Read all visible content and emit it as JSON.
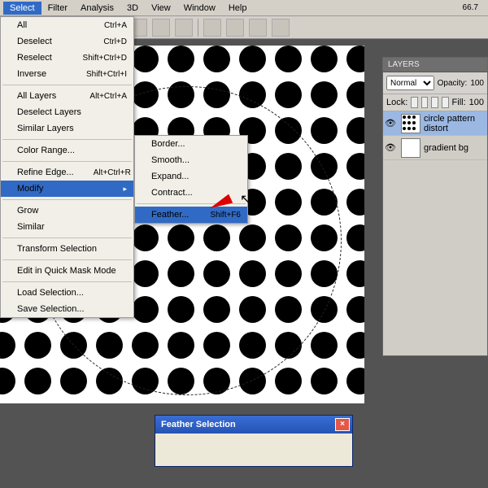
{
  "zoom": "66.7",
  "menubar": [
    "Select",
    "Filter",
    "Analysis",
    "3D",
    "View",
    "Window",
    "Help"
  ],
  "menu_select": {
    "all": {
      "label": "All",
      "sc": "Ctrl+A"
    },
    "deselect": {
      "label": "Deselect",
      "sc": "Ctrl+D"
    },
    "reselect": {
      "label": "Reselect",
      "sc": "Shift+Ctrl+D"
    },
    "inverse": {
      "label": "Inverse",
      "sc": "Shift+Ctrl+I"
    },
    "all_layers": {
      "label": "All Layers",
      "sc": "Alt+Ctrl+A"
    },
    "deselect_layers": {
      "label": "Deselect Layers"
    },
    "similar_layers": {
      "label": "Similar Layers"
    },
    "color_range": {
      "label": "Color Range..."
    },
    "refine_edge": {
      "label": "Refine Edge...",
      "sc": "Alt+Ctrl+R"
    },
    "modify": {
      "label": "Modify"
    },
    "grow": {
      "label": "Grow"
    },
    "similar": {
      "label": "Similar"
    },
    "transform": {
      "label": "Transform Selection"
    },
    "quick_mask": {
      "label": "Edit in Quick Mask Mode"
    },
    "load": {
      "label": "Load Selection..."
    },
    "save": {
      "label": "Save Selection..."
    }
  },
  "menu_modify": {
    "border": {
      "label": "Border..."
    },
    "smooth": {
      "label": "Smooth..."
    },
    "expand": {
      "label": "Expand..."
    },
    "contract": {
      "label": "Contract..."
    },
    "feather": {
      "label": "Feather...",
      "sc": "Shift+F6"
    }
  },
  "layers_panel": {
    "title": "LAYERS",
    "blend": "Normal",
    "opacity_label": "Opacity:",
    "opacity": "100",
    "lock_label": "Lock:",
    "fill_label": "Fill:",
    "fill": "100",
    "items": [
      {
        "name": "circle pattern distort",
        "selected": true,
        "pattern": true
      },
      {
        "name": "gradient bg",
        "selected": false,
        "pattern": false
      }
    ]
  },
  "dialog": {
    "title": "Feather Selection"
  }
}
